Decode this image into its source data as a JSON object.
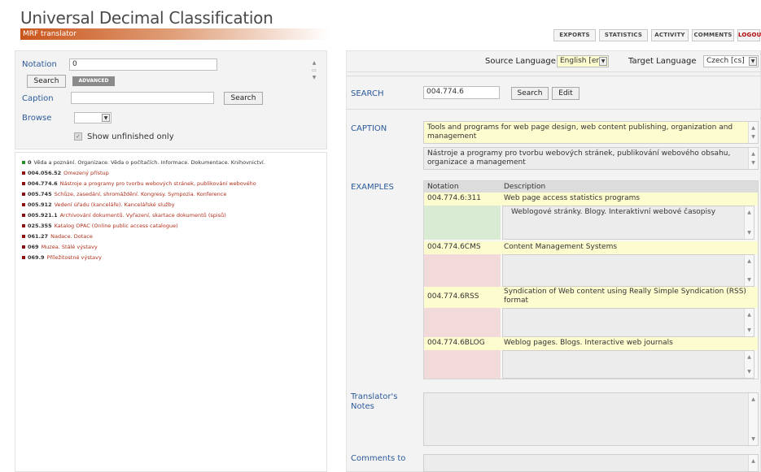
{
  "header": {
    "title": "Universal Decimal Classification",
    "subtitle": "MRF translator",
    "nav": [
      "EXPORTS",
      "STATISTICS",
      "ACTIVITY",
      "COMMENTS",
      "LOGOUT"
    ]
  },
  "left_search": {
    "notation_label": "Notation",
    "notation_value": "0",
    "search_label": "Search",
    "advanced_label": "ADVANCED",
    "caption_label": "Caption",
    "caption_value": "",
    "caption_search_label": "Search",
    "browse_label": "Browse",
    "show_unfinished_label": "Show unfinished only"
  },
  "tree": {
    "root": {
      "notation": "0",
      "text": "Věda a poznání. Organizace. Věda o počítačích. Informace. Dokumentace. Knihovnictví."
    },
    "items": [
      {
        "notation": "004.056.52",
        "text": "Omezený přístup"
      },
      {
        "notation": "004.774.6",
        "text": "Nástroje a programy pro tvorbu webových stránek, publikování webového"
      },
      {
        "notation": "005.745",
        "text": "Schůze, zasedání, shromáždění. Kongresy. Sympozia. Konference"
      },
      {
        "notation": "005.912",
        "text": "Vedení úřadu (kanceláře). Kancelářské služby"
      },
      {
        "notation": "005.921.1",
        "text": "Archivování dokumentů. Vyřazení, skartace dokumentů (spisů)"
      },
      {
        "notation": "025.355",
        "text": "Katalog OPAC (Online public access catalogue)"
      },
      {
        "notation": "061.27",
        "text": "Nadace. Dotace"
      },
      {
        "notation": "069",
        "text": "Muzea. Stálé výstavy"
      },
      {
        "notation": "069.9",
        "text": "Příležitostné výstavy"
      }
    ]
  },
  "languages": {
    "source_label": "Source Language",
    "source_value": "English [en]",
    "target_label": "Target Language",
    "target_value": "Czech [cs]"
  },
  "search": {
    "label": "SEARCH",
    "value": "004.774.6",
    "search_btn": "Search",
    "edit_btn": "Edit"
  },
  "caption": {
    "label": "CAPTION",
    "source_text": "Tools and programs for web page design, web content publishing, organization and management",
    "target_text": "Nástroje a programy pro tvorbu webových stránek, publikování webového obsahu, organizace a management"
  },
  "examples": {
    "label": "EXAMPLES",
    "col_notation": "Notation",
    "col_description": "Description",
    "rows": [
      {
        "notation": "004.774.6:311",
        "description": "Web page access statistics programs",
        "translation": "Weblogové stránky. Blogy. Interaktivní webové časopisy"
      },
      {
        "notation": "004.774.6CMS",
        "description": "Content Management Systems",
        "translation": ""
      },
      {
        "notation": "004.774.6RSS",
        "description": "Syndication of Web content using Really Simple Syndication (RSS) format",
        "translation": ""
      },
      {
        "notation": "004.774.6BLOG",
        "description": "Weblog pages. Blogs. Interactive web journals",
        "translation": ""
      }
    ]
  },
  "notes": {
    "translators_notes_label": "Translator's Notes",
    "comments_label": "Comments to"
  },
  "colors": {
    "accent_orange": "#c9541a",
    "label_blue": "#2b5a9a",
    "source_yellow": "#fdfccf",
    "logout_red": "#b00000"
  }
}
